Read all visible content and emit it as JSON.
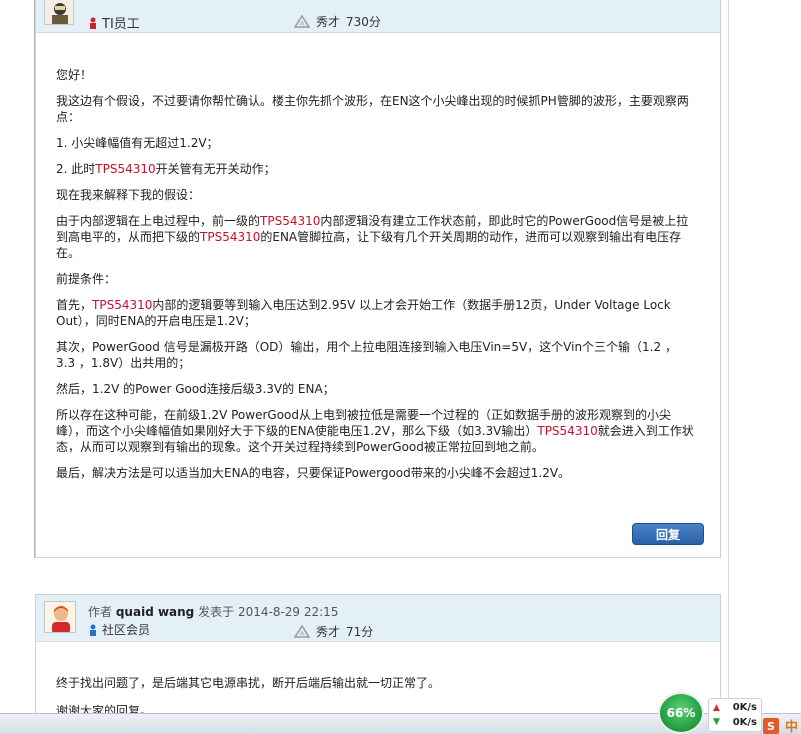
{
  "post1": {
    "rank": "TI员工",
    "honor_label": "秀才",
    "honor_points": "730分",
    "paragraphs": {
      "p1": "您好！",
      "p2": "我这边有个假设，不过要请你帮忙确认。楼主你先抓个波形，在EN这个小尖峰出现的时候抓PH管脚的波形，主要观察两点：",
      "p3": "1. 小尖峰幅值有无超过1.2V；",
      "p4a": "2. 此时",
      "p4b": "TPS54310",
      "p4c": "开关管有无开关动作；",
      "p5": "现在我来解释下我的假设：",
      "p6a": "由于内部逻辑在上电过程中，前一级的",
      "p6b": "TPS54310",
      "p6c": "内部逻辑没有建立工作状态前，即此时它的PowerGood信号是被上拉到高电平的，从而把下级的",
      "p6d": "TPS54310",
      "p6e": "的ENA管脚拉高，让下级有几个开关周期的动作，进而可以观察到输出有电压存在。",
      "p7": "前提条件：",
      "p8a": "首先，",
      "p8b": "TPS54310",
      "p8c": "内部的逻辑要等到输入电压达到2.95V 以上才会开始工作（数据手册12页，Under Voltage Lock Out），同时ENA的开启电压是1.2V；",
      "p9": "其次，PowerGood 信号是漏极开路（OD）输出，用个上拉电阻连接到输入电压Vin=5V，这个Vin个三个输（1.2 ，  3.3 ，1.8V）出共用的；",
      "p10": "然后，1.2V 的Power Good连接后级3.3V的 ENA；",
      "p11a": "所以存在这种可能，在前级1.2V PowerGood从上电到被拉低是需要一个过程的（正如数据手册的波形观察到的小尖峰），而这个小尖峰幅值如果刚好大于下级的ENA使能电压1.2V，那么下级（如3.3V输出）",
      "p11b": "TPS54310",
      "p11c": "就会进入到工作状态，从而可以观察到有输出的现象。这个开关过程持续到PowerGood被正常拉回到地之前。",
      "p12": "最后，解决方法是可以适当加大ENA的电容，只要保证Powergood带来的小尖峰不会超过1.2V。"
    },
    "reply_label": "回复"
  },
  "post2": {
    "author_prefix": "作者",
    "author": "quaid wang",
    "posted_prefix": "发表于",
    "posted_at": "2014-8-29 22:15",
    "rank": "社区会员",
    "honor_label": "秀才",
    "honor_points": "71分",
    "p1": "终于找出问题了，是后端其它电源串扰，断开后端后输出就一切正常了。",
    "p2": "谢谢大家的回复。"
  },
  "tray": {
    "cpu_percent": "66%",
    "upload": "0K/s",
    "download": "0K/s",
    "app_letter": "S",
    "ime": "中"
  },
  "colors": {
    "highlight": "#c8102e",
    "header_bg": "#e4f0f8",
    "button": "#2a5fa6"
  }
}
